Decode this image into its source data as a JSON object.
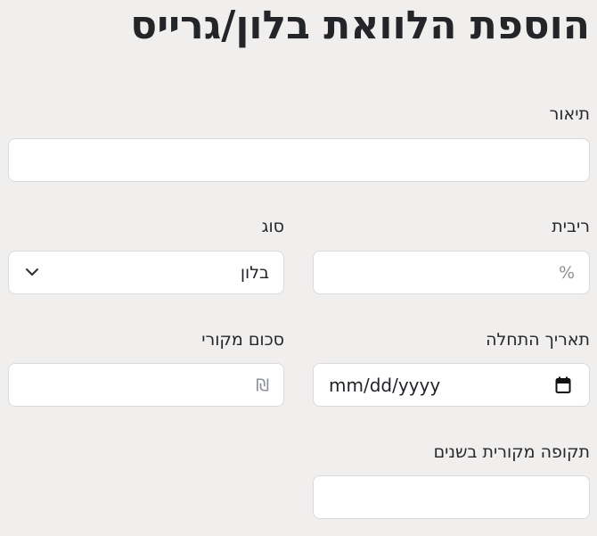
{
  "page": {
    "title": "הוספת הלוואת בלון/גרייס"
  },
  "form": {
    "description": {
      "label": "תיאור",
      "value": "",
      "placeholder": ""
    },
    "interest": {
      "label": "ריבית",
      "value": "",
      "placeholder": "%"
    },
    "type": {
      "label": "סוג",
      "selected": "בלון"
    },
    "start_date": {
      "label": "תאריך התחלה",
      "value": "mm/dd/yyyy"
    },
    "original_amount": {
      "label": "סכום מקורי",
      "value": "",
      "placeholder": "₪"
    },
    "original_period_years": {
      "label": "תקופה מקורית בשנים",
      "value": "",
      "placeholder": ""
    }
  },
  "icons": {
    "select_chevron": "chevron-down-icon",
    "calendar": "calendar-icon"
  }
}
